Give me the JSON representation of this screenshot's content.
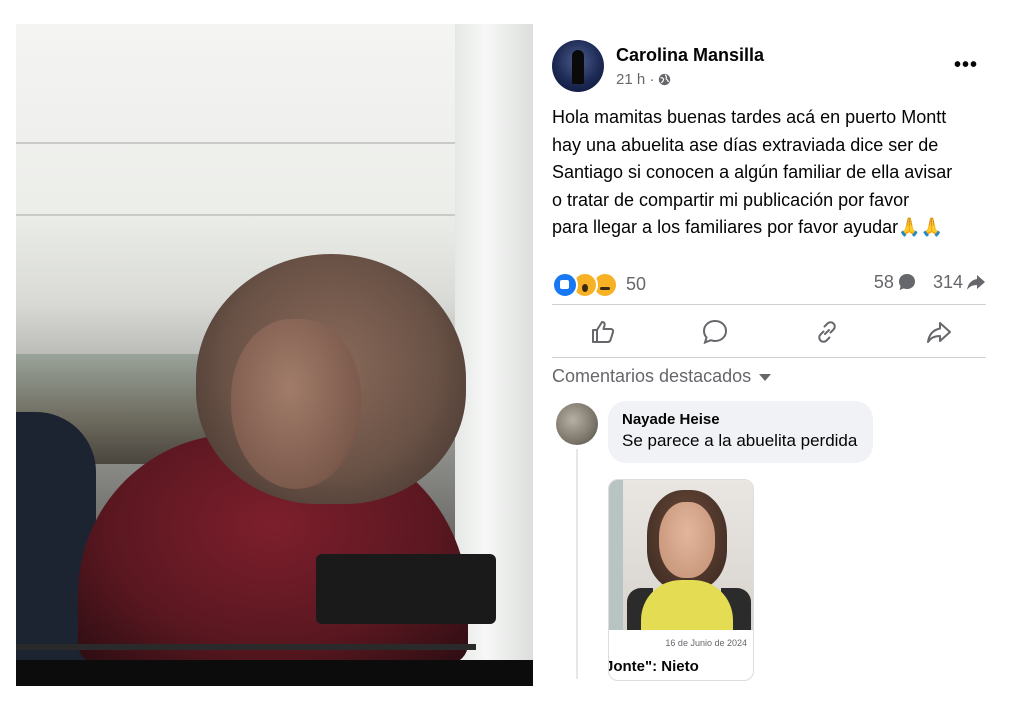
{
  "post": {
    "author": "Carolina Mansilla",
    "time": "21 h ·",
    "more_label": "•••",
    "text": "Hola mamitas buenas tardes acá en puerto Montt\nhay una abuelita ase días extraviada dice ser de\nSantiago si conocen a algún familiar de ella avisar\no tratar de compartir mi publicación por favor\npara llegar a los familiares por favor ayudar🙏🙏",
    "reactions": [
      "like",
      "wow",
      "sad"
    ],
    "reaction_count": "50",
    "comment_count": "58",
    "share_count": "314",
    "actions": [
      "like-icon",
      "comment-icon",
      "link-icon",
      "share-icon"
    ]
  },
  "comments_section": {
    "heading": "Comentarios destacados",
    "top_comment": {
      "author": "Nayade Heise",
      "text": "Se parece a la abuelita perdida",
      "attachment": {
        "date": "16 de Junio de 2024",
        "title": "Jonte\": Nieto"
      }
    }
  },
  "colors": {
    "text": "#050505",
    "secondary": "#65676b",
    "like_blue": "#1877f2",
    "bubble": "#f0f2f5"
  }
}
